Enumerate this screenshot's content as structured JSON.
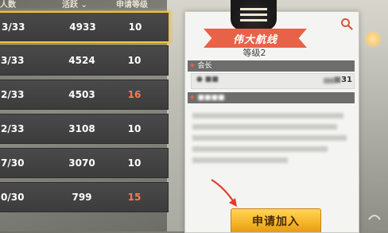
{
  "list": {
    "headers": {
      "members": "人数",
      "activity": "活跃",
      "level": "申请等级"
    },
    "rows": [
      {
        "members": "3/33",
        "activity": "4933",
        "level": "10",
        "level_highlight": false,
        "selected": true
      },
      {
        "members": "3/33",
        "activity": "4524",
        "level": "10",
        "level_highlight": false,
        "selected": false
      },
      {
        "members": "2/33",
        "activity": "4503",
        "level": "16",
        "level_highlight": true,
        "selected": false
      },
      {
        "members": "2/33",
        "activity": "3108",
        "level": "10",
        "level_highlight": false,
        "selected": false
      },
      {
        "members": "7/30",
        "activity": "3070",
        "level": "10",
        "level_highlight": false,
        "selected": false
      },
      {
        "members": "0/30",
        "activity": "799",
        "level": "15",
        "level_highlight": true,
        "selected": false
      }
    ]
  },
  "panel": {
    "title": "伟大航线",
    "level": "等级2",
    "leader_section": "会长",
    "leader_level": "31",
    "apply_label": "申请加入"
  },
  "colors": {
    "accent": "#e86247",
    "button": "#f5b526",
    "selected_border": "#f1c540",
    "level_highlight": "#ff7a4a"
  }
}
